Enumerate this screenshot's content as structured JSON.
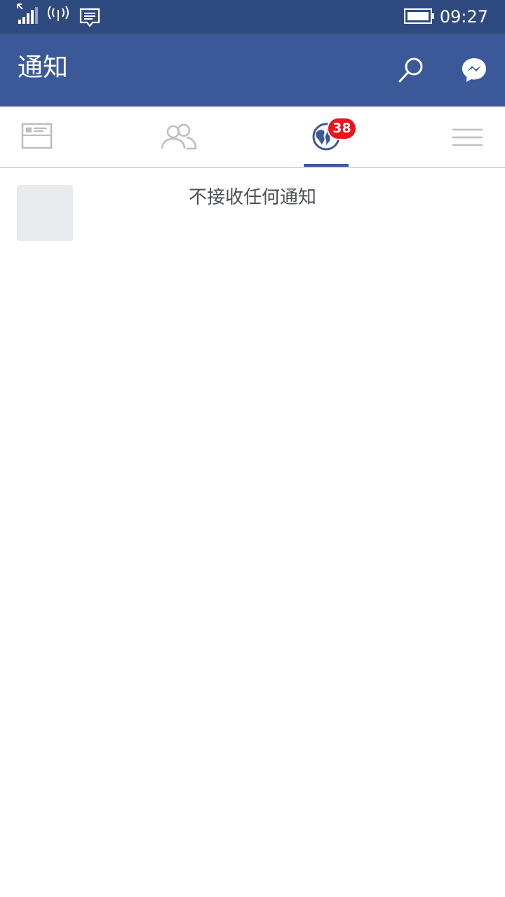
{
  "status_bar": {
    "time": "09:27",
    "icons": [
      "signal-icon",
      "hotspot-icon",
      "message-icon",
      "battery-icon"
    ]
  },
  "header": {
    "title": "通知",
    "actions": [
      "search-icon",
      "messenger-icon"
    ],
    "background_color": "#3b5998"
  },
  "tabs": [
    {
      "name": "news-feed",
      "icon": "news-feed-icon",
      "active": false
    },
    {
      "name": "friends",
      "icon": "friends-icon",
      "active": false
    },
    {
      "name": "notifications",
      "icon": "globe-icon",
      "active": true,
      "badge": "38"
    },
    {
      "name": "menu",
      "icon": "menu-icon",
      "active": false
    }
  ],
  "colors": {
    "accent": "#3b5998",
    "badge": "#f0121b",
    "inactive_icon": "#bdbdbd"
  },
  "main": {
    "empty_message": "不接收任何通知"
  }
}
